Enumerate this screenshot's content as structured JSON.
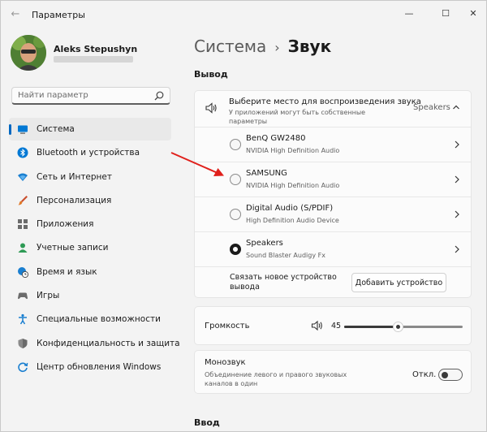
{
  "window": {
    "title": "Параметры",
    "back": "←",
    "minimize": "—",
    "maximize": "☐",
    "close": "✕"
  },
  "user": {
    "name": "Aleks Stepushyn"
  },
  "search": {
    "placeholder": "Найти параметр",
    "icon": "search-icon"
  },
  "sidebar": {
    "items": [
      {
        "label": "Система",
        "icon": "monitor-icon",
        "active": true
      },
      {
        "label": "Bluetooth и устройства",
        "icon": "bluetooth-icon"
      },
      {
        "label": "Сеть и Интернет",
        "icon": "wifi-icon"
      },
      {
        "label": "Персонализация",
        "icon": "brush-icon"
      },
      {
        "label": "Приложения",
        "icon": "apps-icon"
      },
      {
        "label": "Учетные записи",
        "icon": "user-icon"
      },
      {
        "label": "Время и язык",
        "icon": "globe-clock-icon"
      },
      {
        "label": "Игры",
        "icon": "gamepad-icon"
      },
      {
        "label": "Специальные возможности",
        "icon": "accessibility-icon"
      },
      {
        "label": "Конфиденциальность и защита",
        "icon": "shield-icon"
      },
      {
        "label": "Центр обновления Windows",
        "icon": "update-icon"
      }
    ]
  },
  "breadcrumb": {
    "parent": "Система",
    "separator": "›",
    "current": "Звук"
  },
  "output": {
    "section_title": "Вывод",
    "header_title": "Выберите место для воспроизведения звука",
    "header_subtitle": "У приложений могут быть собственные параметры",
    "selected": "Speakers",
    "devices": [
      {
        "name": "BenQ GW2480",
        "driver": "NVIDIA High Definition Audio",
        "selected": false
      },
      {
        "name": "SAMSUNG",
        "driver": "NVIDIA High Definition Audio",
        "selected": false
      },
      {
        "name": "Digital Audio (S/PDIF)",
        "driver": "High Definition Audio Device",
        "selected": false
      },
      {
        "name": "Speakers",
        "driver": "Sound Blaster Audigy Fx",
        "selected": true
      }
    ],
    "pair_label": "Связать новое устройство вывода",
    "add_device_button": "Добавить устройство"
  },
  "volume": {
    "label": "Громкость",
    "value": "45",
    "level": 0.45
  },
  "mono": {
    "title": "Монозвук",
    "subtitle": "Объединение левого и правого звуковых каналов в один",
    "state_label": "Откл.",
    "on": false
  },
  "input": {
    "section_title": "Ввод"
  },
  "colors": {
    "accent": "#0067c0",
    "annotation": "#e0201b"
  }
}
